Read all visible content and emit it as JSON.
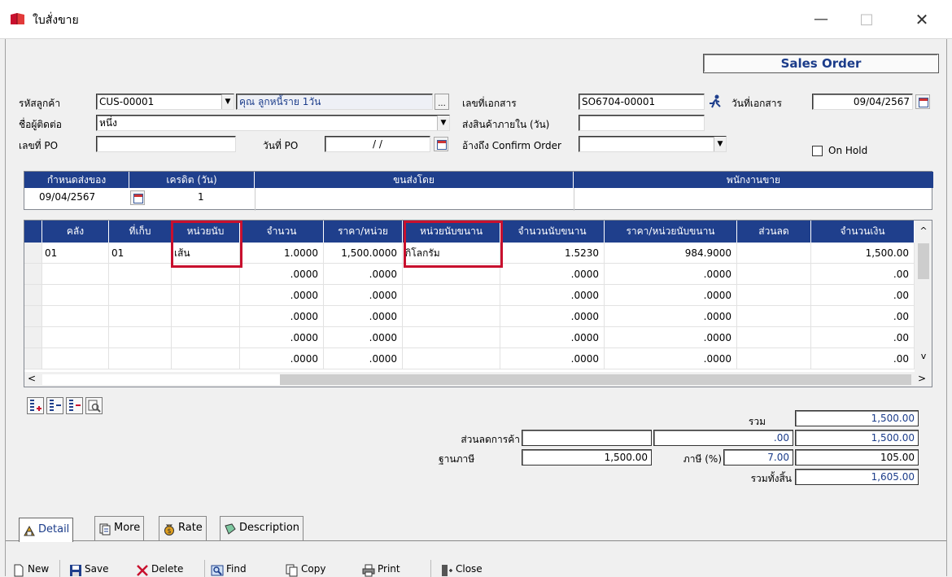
{
  "window": {
    "title": "ใบสั่งขาย",
    "min_glyph": "—",
    "max_glyph": "□",
    "close_glyph": "✕"
  },
  "banner": "Sales Order",
  "form": {
    "customer_code_label": "รหัสลูกค้า",
    "customer_code": "CUS-00001",
    "customer_name": "คุณ ลูกหนี้ราย 1วัน",
    "doc_no_label": "เลขที่เอกสาร",
    "doc_no": "SO6704-00001",
    "doc_date_label": "วันที่เอกสาร",
    "doc_date": "09/04/2567",
    "contact_label": "ชื่อผู้ติดต่อ",
    "contact": "หนึ่ง",
    "deliver_within_label": "ส่งสินค้าภายใน (วัน)",
    "deliver_within": "",
    "po_no_label": "เลขที่ PO",
    "po_no": "",
    "po_date_label": "วันที่ PO",
    "po_date": "/ /",
    "confirm_ref_label": "อ้างถึง Confirm Order",
    "confirm_ref": "",
    "on_hold_label": "On Hold",
    "browse_glyph": "..."
  },
  "delivery": {
    "headers": [
      "กำหนดส่งของ",
      "เครดิต (วัน)",
      "ขนส่งโดย",
      "พนักงานขาย"
    ],
    "due_date": "09/04/2567",
    "credit_days": "1",
    "shipper": "",
    "salesman": ""
  },
  "grid": {
    "columns": [
      "คลัง",
      "ที่เก็บ",
      "หน่วยนับ",
      "จำนวน",
      "ราคา/หน่วย",
      "หน่วยนับขนาน",
      "จำนวนนับขนาน",
      "ราคา/หน่วยนับขนาน",
      "ส่วนลด",
      "จำนวนเงิน"
    ],
    "rows": [
      [
        "01",
        "01",
        "เส้น",
        "1.0000",
        "1,500.0000",
        "กิโลกรัม",
        "1.5230",
        "984.9000",
        "",
        "1,500.00"
      ],
      [
        "",
        "",
        "",
        ".0000",
        ".0000",
        "",
        ".0000",
        ".0000",
        "",
        ".00"
      ],
      [
        "",
        "",
        "",
        ".0000",
        ".0000",
        "",
        ".0000",
        ".0000",
        "",
        ".00"
      ],
      [
        "",
        "",
        "",
        ".0000",
        ".0000",
        "",
        ".0000",
        ".0000",
        "",
        ".00"
      ],
      [
        "",
        "",
        "",
        ".0000",
        ".0000",
        "",
        ".0000",
        ".0000",
        "",
        ".00"
      ],
      [
        "",
        "",
        "",
        ".0000",
        ".0000",
        "",
        ".0000",
        ".0000",
        "",
        ".00"
      ]
    ],
    "scroll_left": "<",
    "scroll_right": ">",
    "scroll_up": "^",
    "scroll_down": "v"
  },
  "totals": {
    "sum_label": "รวม",
    "sum": "1,500.00",
    "discount_label": "ส่วนลดการค้า",
    "discount_input": "",
    "discount_amount": ".00",
    "after_discount": "1,500.00",
    "tax_base_label": "ฐานภาษี",
    "tax_base": "1,500.00",
    "tax_rate_label": "ภาษี (%)",
    "tax_rate": "7.00",
    "tax_amount": "105.00",
    "grand_total_label": "รวมทั้งสิ้น",
    "grand_total": "1,605.00"
  },
  "tabs": [
    "Detail",
    "More",
    "Rate",
    "Description"
  ],
  "toolbar": {
    "new": "New",
    "save": "Save",
    "delete": "Delete",
    "find": "Find",
    "copy": "Copy",
    "print": "Print",
    "close": "Close"
  },
  "colors": {
    "header_blue": "#1f3f8c",
    "highlight_red": "#c8102e",
    "value_blue": "#1b3c8a"
  }
}
